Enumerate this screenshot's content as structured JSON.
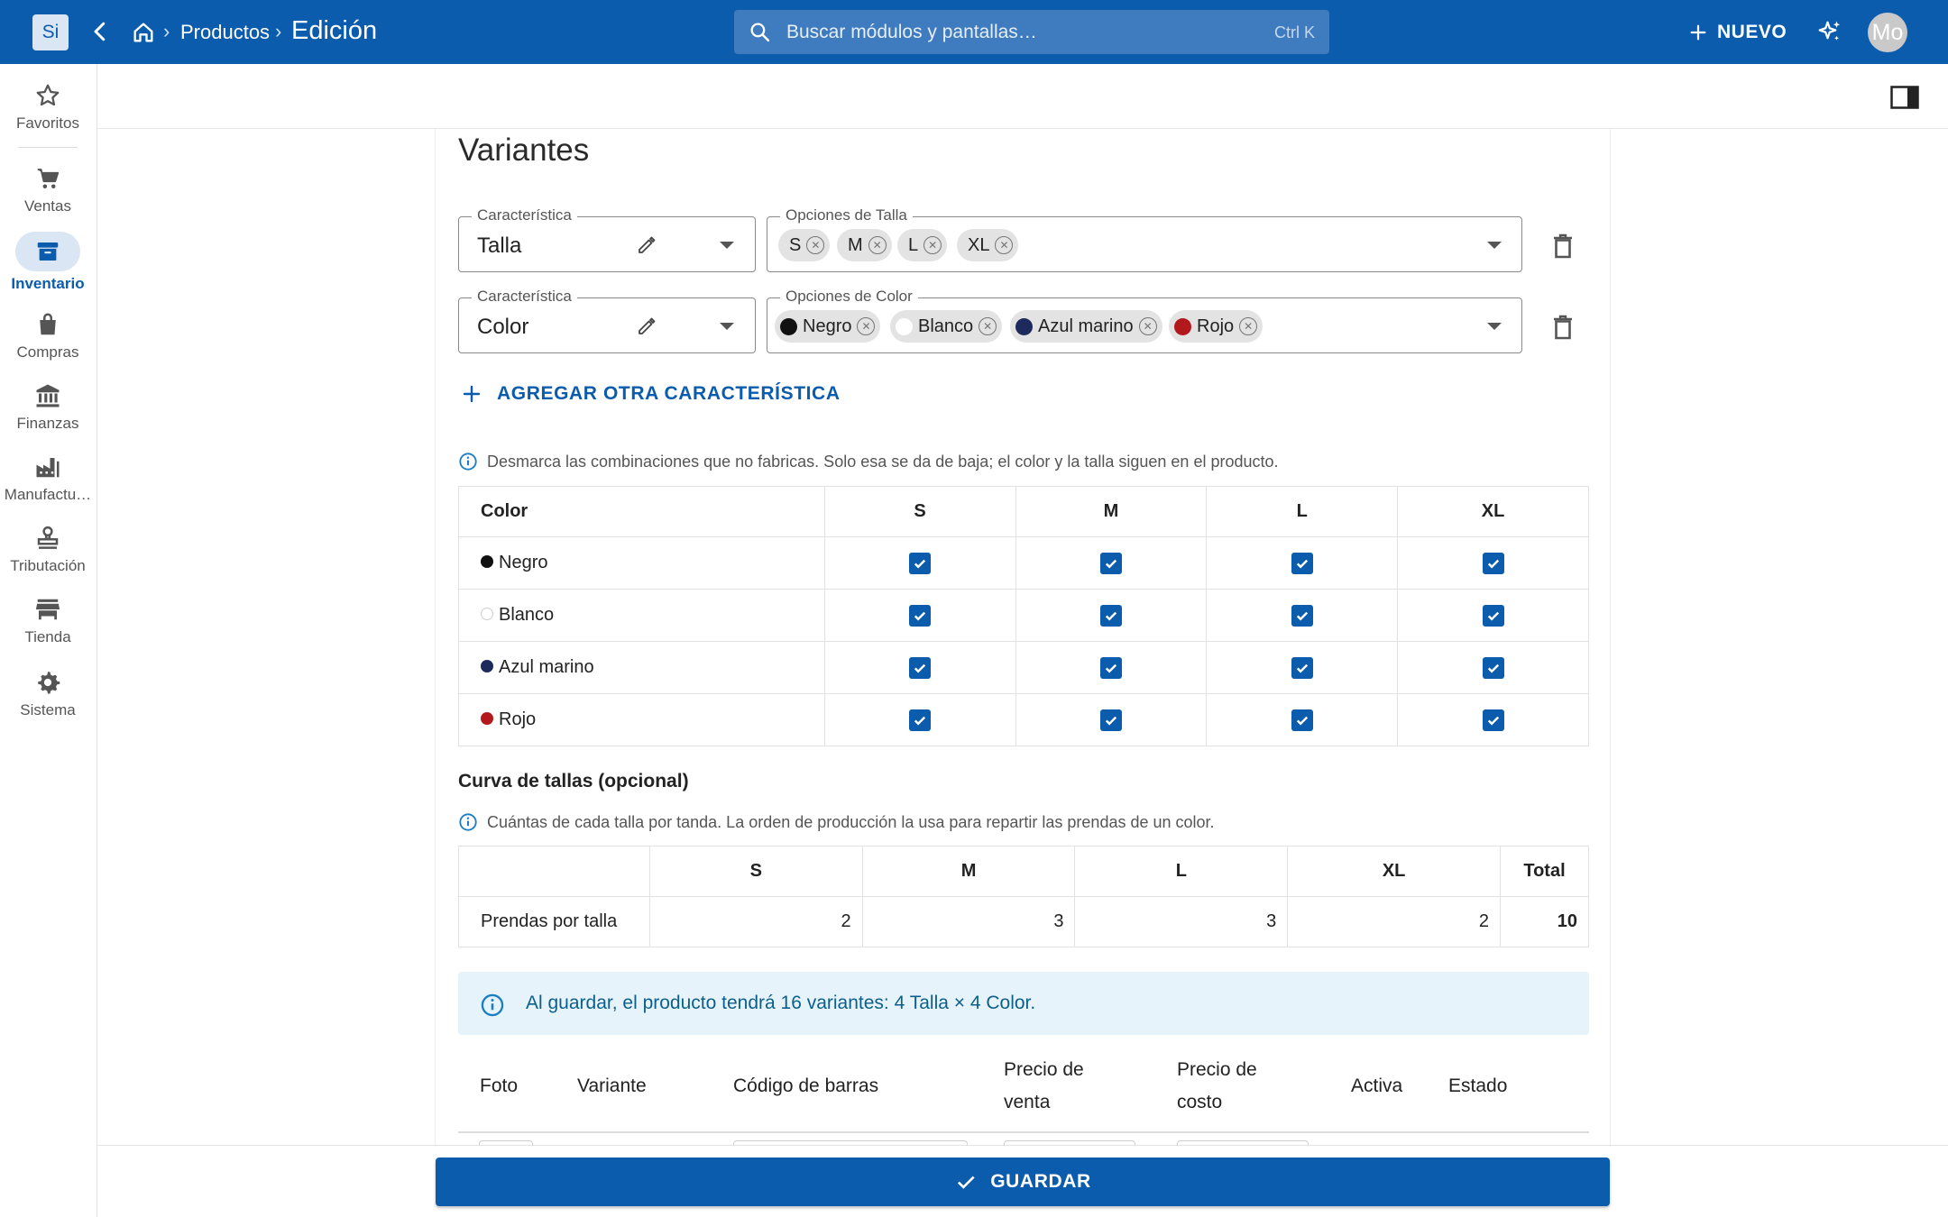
{
  "app": {
    "logo_text": "Si",
    "avatar_text": "Mo",
    "brand_color": "#0b5cad"
  },
  "breadcrumb": {
    "item1": "Productos",
    "current": "Edición",
    "separator": "›"
  },
  "search": {
    "placeholder": "Buscar módulos y pantallas…",
    "shortcut": "Ctrl K"
  },
  "header": {
    "new_label": "NUEVO"
  },
  "sidebar": {
    "items": [
      {
        "label": "Favoritos",
        "icon": "star-icon"
      },
      {
        "label": "Ventas",
        "icon": "cart-icon"
      },
      {
        "label": "Inventario",
        "icon": "archive-icon",
        "active": true
      },
      {
        "label": "Compras",
        "icon": "bag-icon"
      },
      {
        "label": "Finanzas",
        "icon": "bank-icon"
      },
      {
        "label": "Manufactu…",
        "icon": "factory-icon"
      },
      {
        "label": "Tributación",
        "icon": "stamp-icon"
      },
      {
        "label": "Tienda",
        "icon": "store-icon"
      },
      {
        "label": "Sistema",
        "icon": "gear-icon"
      }
    ]
  },
  "variantes": {
    "title": "Variantes",
    "characteristic_label": "Característica",
    "rows": [
      {
        "characteristic": "Talla",
        "options_label": "Opciones de Talla",
        "chips": [
          {
            "label": "S"
          },
          {
            "label": "M"
          },
          {
            "label": "L"
          },
          {
            "label": "XL"
          }
        ]
      },
      {
        "characteristic": "Color",
        "options_label": "Opciones de Color",
        "chips": [
          {
            "label": "Negro",
            "color": "#111111"
          },
          {
            "label": "Blanco",
            "color": "#ffffff"
          },
          {
            "label": "Azul marino",
            "color": "#1d2a5c"
          },
          {
            "label": "Rojo",
            "color": "#b3191c"
          }
        ]
      }
    ],
    "add_label": "AGREGAR OTRA CARACTERÍSTICA",
    "combo_info": "Desmarca las combinaciones que no fabricas. Solo esa se da de baja; el color y la talla siguen en el producto.",
    "combo_table": {
      "headers": [
        "Color",
        "S",
        "M",
        "L",
        "XL"
      ],
      "rows": [
        {
          "name": "Negro",
          "color": "#111111",
          "checks": [
            true,
            true,
            true,
            true
          ]
        },
        {
          "name": "Blanco",
          "color": "#ffffff",
          "checks": [
            true,
            true,
            true,
            true
          ]
        },
        {
          "name": "Azul marino",
          "color": "#1d2a5c",
          "checks": [
            true,
            true,
            true,
            true
          ]
        },
        {
          "name": "Rojo",
          "color": "#b3191c",
          "checks": [
            true,
            true,
            true,
            true
          ]
        }
      ]
    },
    "curve_title": "Curva de tallas (opcional)",
    "curve_info": "Cuántas de cada talla por tanda. La orden de producción la usa para repartir las prendas de un color.",
    "curve_table": {
      "headers": [
        "",
        "S",
        "M",
        "L",
        "XL",
        "Total"
      ],
      "row_label": "Prendas por talla",
      "values": [
        "2",
        "3",
        "3",
        "2"
      ],
      "total": "10"
    },
    "summary": "Al guardar, el producto tendrá 16 variantes: 4 Talla × 4 Color.",
    "variants_headers": {
      "foto": "Foto",
      "variante": "Variante",
      "codigo": "Código de barras",
      "precio_venta_1": "Precio de",
      "precio_venta_2": "venta",
      "precio_costo_1": "Precio de",
      "precio_costo_2": "costo",
      "activa": "Activa",
      "estado": "Estado"
    }
  },
  "footer": {
    "save_label": "GUARDAR"
  }
}
